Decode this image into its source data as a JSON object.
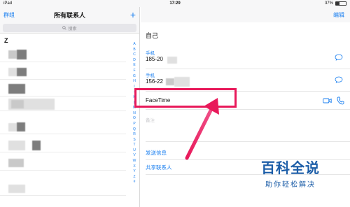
{
  "status_bar": {
    "device": "iPad",
    "time": "17:29",
    "battery": "37%",
    "battery_level": 0.37
  },
  "left_panel": {
    "groups_button": "群组",
    "title": "所有联系人",
    "add_icon": "+",
    "search_placeholder": "搜索",
    "section_header": "Z",
    "index_letters": [
      "A",
      "B",
      "C",
      "D",
      "E",
      "F",
      "G",
      "H",
      "I",
      "J",
      "K",
      "L",
      "M",
      "N",
      "O",
      "P",
      "Q",
      "R",
      "S",
      "T",
      "U",
      "V",
      "W",
      "X",
      "Y",
      "Z",
      "#"
    ]
  },
  "detail": {
    "edit_button": "编辑",
    "name": "自己",
    "phones": [
      {
        "label": "手机",
        "value": "185-20"
      },
      {
        "label": "手机",
        "value": "156-22"
      }
    ],
    "facetime_label": "FaceTime",
    "notes_label": "备注",
    "actions": {
      "send_message": "发送信息",
      "share_contact": "共享联系人"
    }
  },
  "annotation": {
    "highlight_color": "#e8195a"
  },
  "watermark": {
    "main": "百科全说",
    "sub": "助你轻松解决"
  },
  "colors": {
    "accent": "#1a7ff0"
  }
}
